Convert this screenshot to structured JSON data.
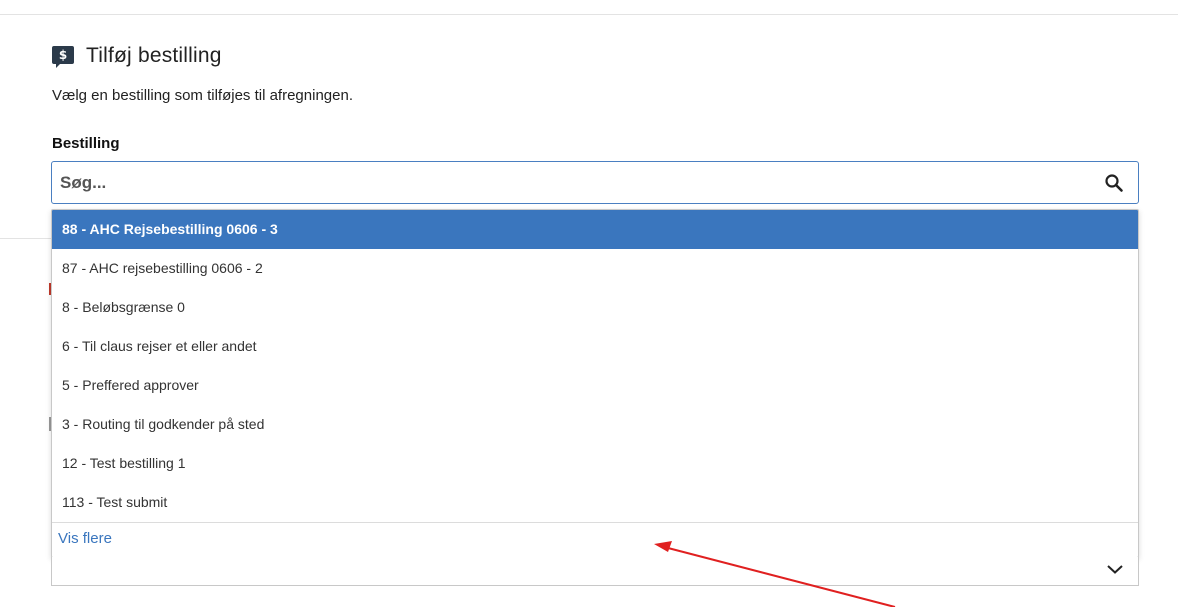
{
  "panel": {
    "icon": "dollar-chat-icon",
    "icon_glyph": "$",
    "title": "Tilføj bestilling",
    "subtitle": "Vælg en bestilling som tilføjes til afregningen."
  },
  "field": {
    "label": "Bestilling",
    "search_placeholder": "Søg...",
    "search_value": "",
    "search_icon": "search-icon"
  },
  "dropdown": {
    "options": [
      {
        "label": "88 - AHC Rejsebestilling 0606 - 3",
        "selected": true
      },
      {
        "label": "87 - AHC rejsebestilling 0606 - 2",
        "selected": false
      },
      {
        "label": "8 - Beløbsgrænse 0",
        "selected": false
      },
      {
        "label": "6 - Til claus rejser et eller andet",
        "selected": false
      },
      {
        "label": "5 - Preffered approver",
        "selected": false
      },
      {
        "label": "3 - Routing til godkender på sted",
        "selected": false
      },
      {
        "label": "12 - Test bestilling 1",
        "selected": false
      },
      {
        "label": "113 - Test submit",
        "selected": false
      }
    ],
    "show_more_label": "Vis flere"
  },
  "colors": {
    "accent": "#3a76be",
    "annotation_arrow": "#e02020",
    "icon_bg": "#2b3a4a"
  },
  "annotation": {
    "type": "red-arrow",
    "points_to": "show-more-link"
  }
}
